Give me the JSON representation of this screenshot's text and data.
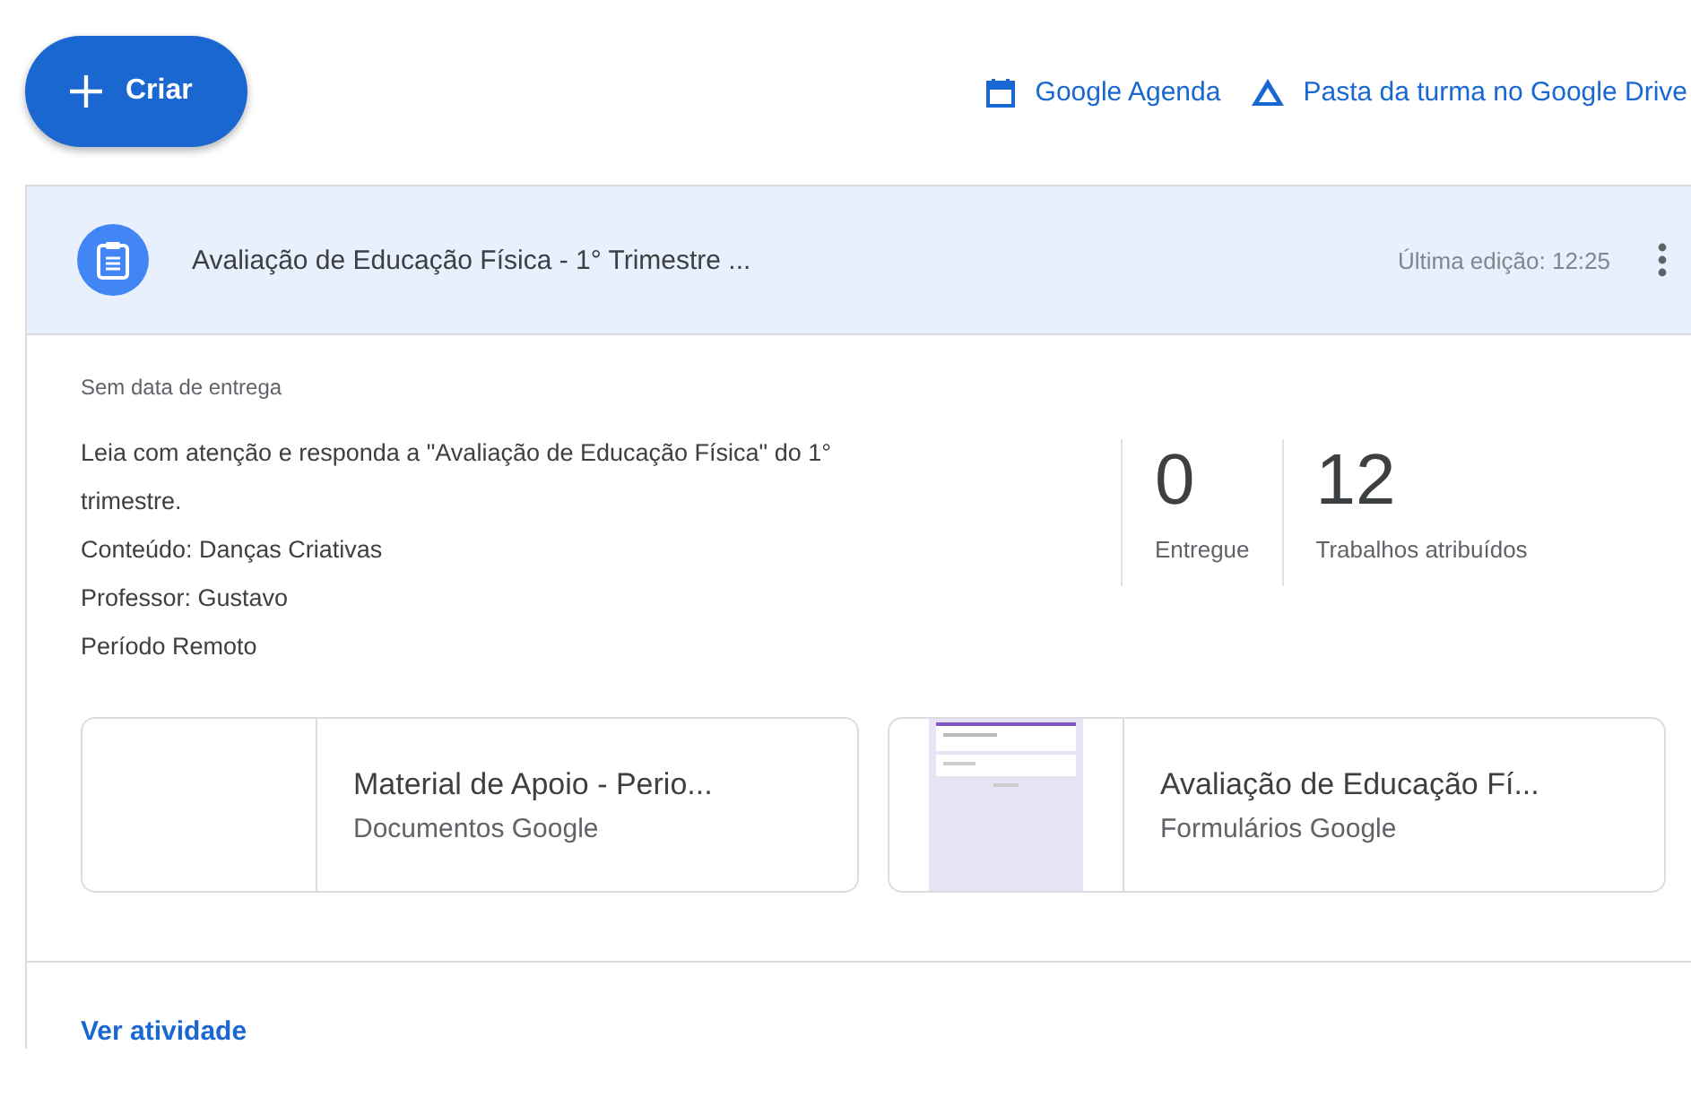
{
  "create_button": {
    "label": "Criar"
  },
  "links": [
    {
      "kind": "calendar",
      "label": "Google Agenda"
    },
    {
      "kind": "drive",
      "label": "Pasta da turma no Google Drive"
    }
  ],
  "assignment": {
    "title": "Avaliação de Educação Física - 1° Trimestre ...",
    "last_edit": "Última edição: 12:25",
    "due": "Sem data de entrega",
    "description": [
      "Leia com atenção e responda a \"Avaliação de Educação Física\" do 1° trimestre.",
      "Conteúdo: Danças Criativas",
      "Professor: Gustavo",
      "Período Remoto"
    ],
    "stats": [
      {
        "value": "0",
        "label": "Entregue"
      },
      {
        "value": "12",
        "label": "Trabalhos atribuídos"
      }
    ],
    "attachments": [
      {
        "kind": "doc",
        "title": "Material de Apoio - Perio...",
        "type": "Documentos Google"
      },
      {
        "kind": "form",
        "title": "Avaliação de Educação Fí...",
        "type": "Formulários Google"
      }
    ],
    "footer_link": "Ver atividade"
  }
}
